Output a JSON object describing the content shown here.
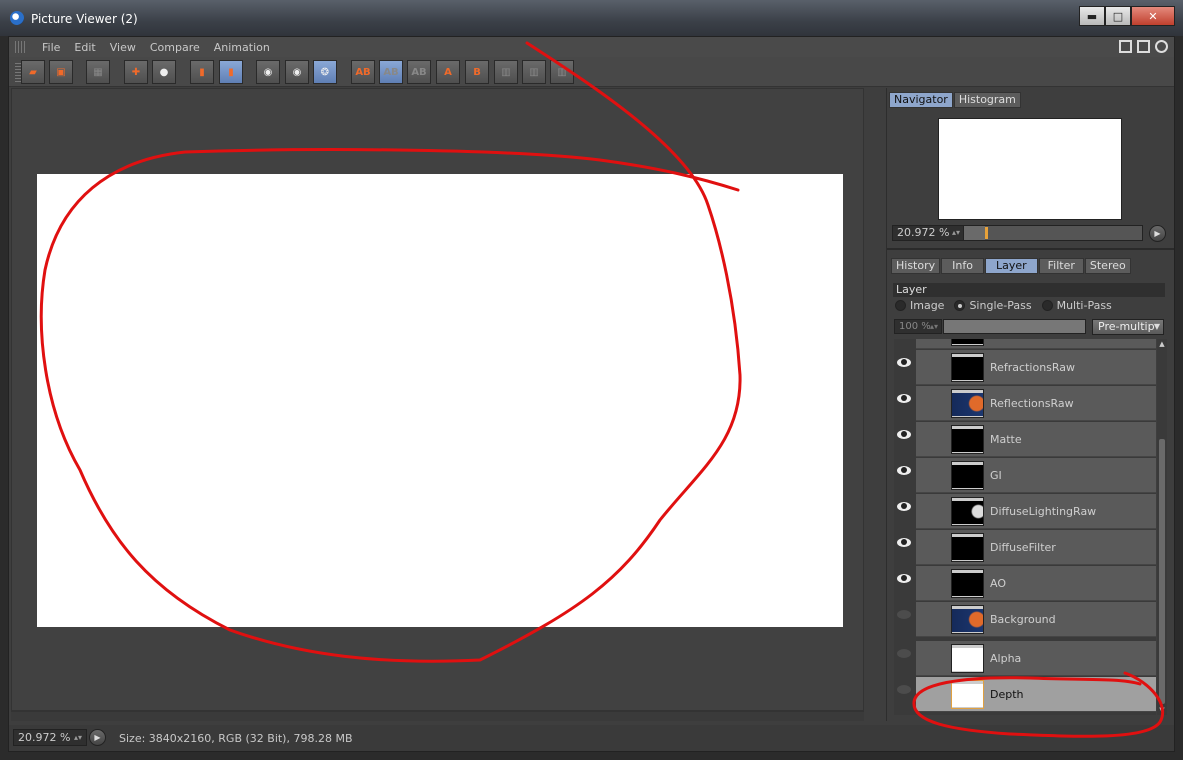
{
  "window": {
    "title": "Picture Viewer (2)",
    "minimize": "▬",
    "maximize": "□",
    "close": "✕"
  },
  "menu": [
    "File",
    "Edit",
    "View",
    "Compare",
    "Animation"
  ],
  "toolbar": {
    "ab_a": "A",
    "ab_b": "B",
    "ab_label": "AB"
  },
  "status": {
    "zoom": "20.972 %",
    "info": "Size: 3840x2160, RGB (32 Bit), 798.28 MB"
  },
  "navigator": {
    "tabs": [
      "Navigator",
      "Histogram"
    ],
    "zoom": "20.972 %",
    "slider_fraction": 0.12
  },
  "panel_tabs": [
    "History",
    "Info",
    "Layer",
    "Filter",
    "Stereo"
  ],
  "layer": {
    "group_label": "Layer",
    "modes": [
      "Image",
      "Single-Pass",
      "Multi-Pass"
    ],
    "selected_mode": "Single-Pass",
    "opacity": "100 %",
    "blend": "Pre-multip",
    "items": [
      {
        "name": "RefractionsRaw",
        "visible": true
      },
      {
        "name": "ReflectionsRaw",
        "visible": true
      },
      {
        "name": "Matte",
        "visible": true
      },
      {
        "name": "GI",
        "visible": true
      },
      {
        "name": "DiffuseLightingRaw",
        "visible": true
      },
      {
        "name": "DiffuseFilter",
        "visible": true
      },
      {
        "name": "AO",
        "visible": true
      },
      {
        "name": "Background",
        "visible": false
      },
      {
        "name": "Alpha",
        "visible": false
      },
      {
        "name": "Depth",
        "visible": false,
        "selected": true
      }
    ]
  },
  "colors": {
    "accent": "#8ea6cc",
    "annotation": "#e01010",
    "canvas": "#ffffff"
  }
}
